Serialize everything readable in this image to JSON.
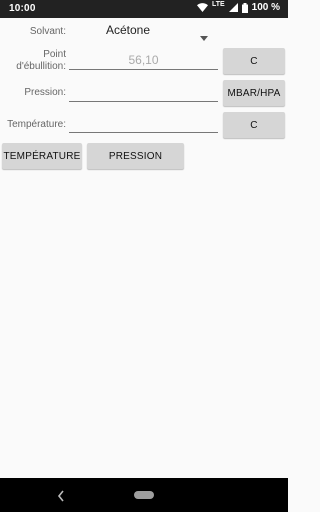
{
  "status_bar": {
    "time": "10:00",
    "network": "LTE",
    "battery": "100 %",
    "icons": [
      "wifi-icon",
      "signal-icon",
      "battery-icon"
    ]
  },
  "form": {
    "solvent_label": "Solvant:",
    "solvent_value": "Acétone",
    "boiling_label_line1": "Point",
    "boiling_label_line2": "d'ébullition:",
    "boiling_value": "56,10",
    "boiling_unit": "C",
    "pressure_label": "Pression:",
    "pressure_value": "",
    "pressure_unit": "MBAR/HPA",
    "temperature_label": "Température:",
    "temperature_value": "",
    "temperature_unit": "C"
  },
  "actions": {
    "temperature_button": "TEMPÉRATURE",
    "pressure_button": "PRESSION"
  },
  "colors": {
    "background": "#fafafa",
    "button": "#d6d6d6",
    "status_bar": "#222222",
    "nav_bar": "#000000"
  }
}
